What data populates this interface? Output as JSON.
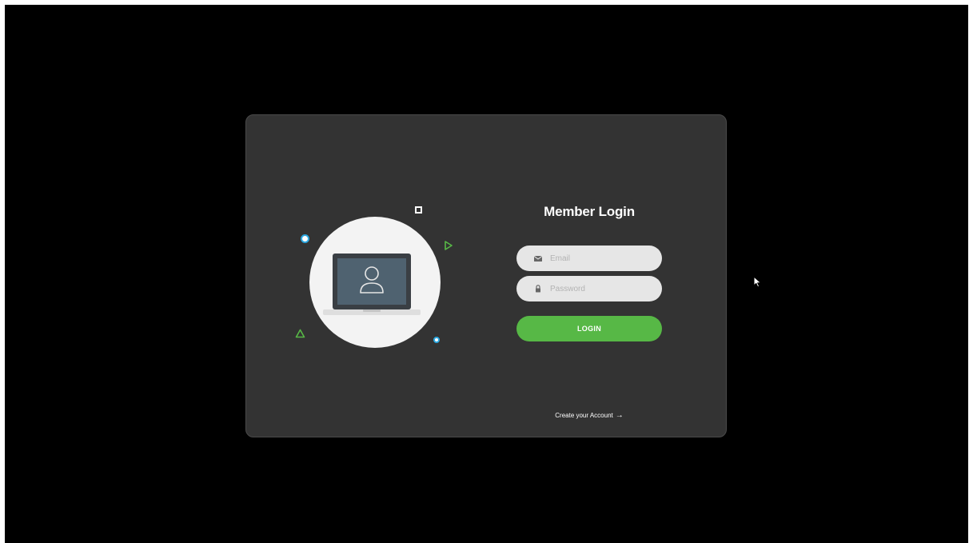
{
  "login_card": {
    "title": "Member Login",
    "email": {
      "value": "",
      "placeholder": "Email",
      "icon": "envelope-icon"
    },
    "password": {
      "value": "",
      "placeholder": "Password",
      "icon": "lock-icon"
    },
    "login_button_label": "LOGIN",
    "create_account_label": "Create your Account",
    "create_account_arrow": "→"
  },
  "illustration": {
    "icon": "laptop-user-icon"
  },
  "colors": {
    "background": "#000000",
    "card": "#333333",
    "accent_green": "#57b846",
    "accent_blue": "#2aa7e0",
    "input_bg": "#e6e6e6"
  }
}
